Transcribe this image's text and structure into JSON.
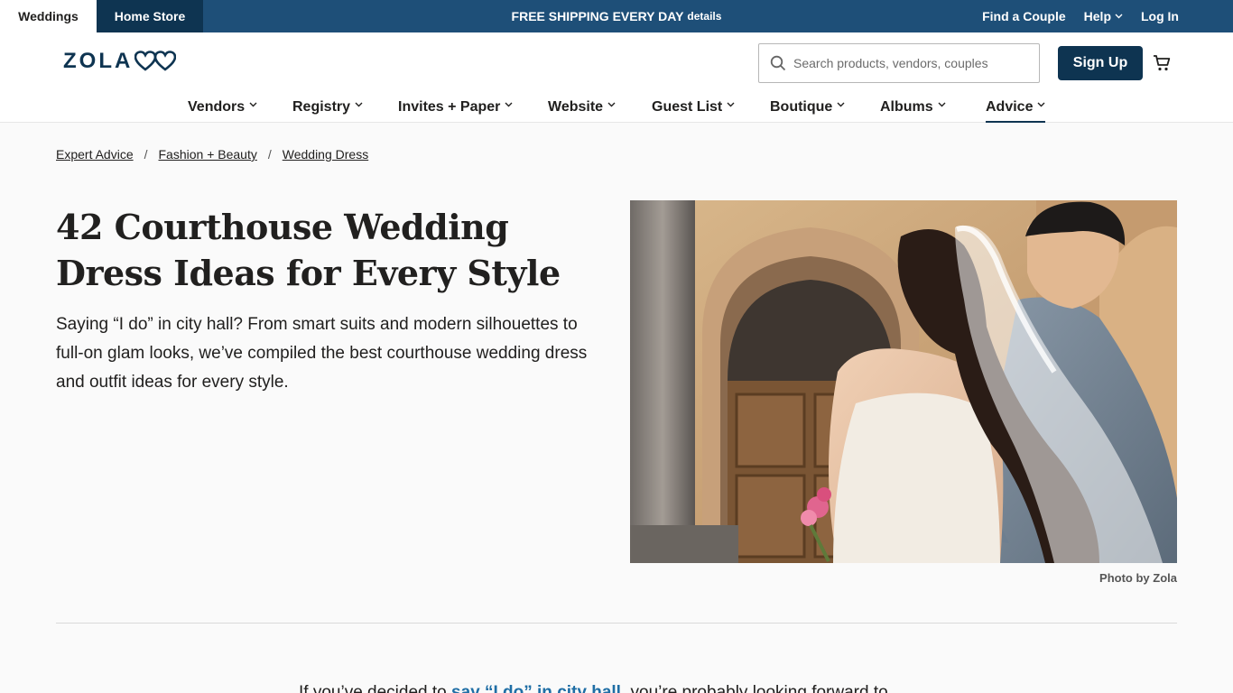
{
  "topbar": {
    "tab_weddings": "Weddings",
    "tab_home_store": "Home Store",
    "promo_text": "FREE SHIPPING EVERY DAY",
    "promo_details": "details",
    "find_couple": "Find a Couple",
    "help": "Help",
    "log_in": "Log In"
  },
  "header": {
    "logo_text": "ZOLA",
    "search_placeholder": "Search products, vendors, couples",
    "signup_label": "Sign Up"
  },
  "nav": {
    "items": [
      "Vendors",
      "Registry",
      "Invites + Paper",
      "Website",
      "Guest List",
      "Boutique",
      "Albums",
      "Advice"
    ],
    "active": "Advice"
  },
  "breadcrumb": [
    "Expert Advice",
    "Fashion + Beauty",
    "Wedding Dress"
  ],
  "article": {
    "title": "42 Courthouse Wedding Dress Ideas for Every Style",
    "lede": "Saying “I do” in city hall? From smart suits and modern silhouettes to full-on glam looks, we’ve compiled the best courthouse wedding dress and outfit ideas for every style.",
    "photo_credit": "Photo by Zola",
    "body_prefix": "If you’ve decided to ",
    "body_link": "say “I do” in city hall",
    "body_suffix": ", you’re probably looking forward to"
  },
  "colors": {
    "brand_navy": "#0e3451",
    "topbar_blue": "#1e4f78",
    "link_blue": "#1f6ea5"
  },
  "icons": [
    "search-icon",
    "cart-icon",
    "chevron-down-icon",
    "zola-hearts-logo"
  ]
}
